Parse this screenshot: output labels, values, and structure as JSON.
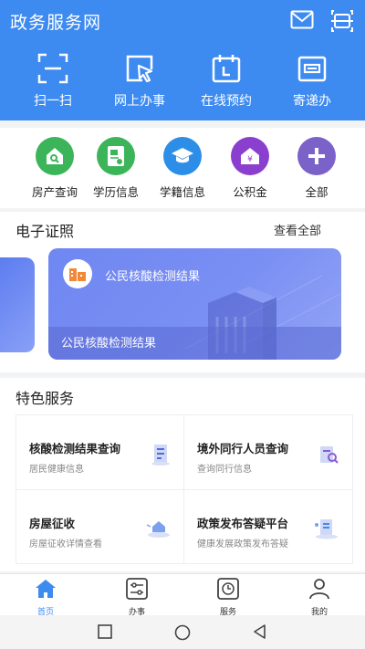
{
  "header": {
    "title": "政务服务网",
    "mail_icon": "mail-icon",
    "scan_icon": "scan-frame-icon"
  },
  "quick_actions": [
    {
      "label": "扫一扫",
      "icon": "scan-icon"
    },
    {
      "label": "网上办事",
      "icon": "cursor-window-icon"
    },
    {
      "label": "在线预约",
      "icon": "calendar-icon"
    },
    {
      "label": "寄递办",
      "icon": "mailbox-icon"
    }
  ],
  "categories": [
    {
      "label": "房产查询",
      "icon": "house-icon",
      "color": "#3cb55a"
    },
    {
      "label": "学历信息",
      "icon": "certificate-icon",
      "color": "#3cb55a"
    },
    {
      "label": "学籍信息",
      "icon": "graduation-cap-icon",
      "color": "#2d8ee8"
    },
    {
      "label": "公积金",
      "icon": "yuan-house-icon",
      "color": "#8b3fcf"
    },
    {
      "label": "全部",
      "icon": "plus-icon",
      "color": "#7b62c9"
    }
  ],
  "e_certificate": {
    "title": "电子证照",
    "see_all": "查看全部",
    "card_title": "公民核酸检测结果",
    "card_footer": "公民核酸检测结果"
  },
  "special_services": {
    "title": "特色服务",
    "items": [
      {
        "title": "核酸检测结果查询",
        "subtitle": "居民健康信息"
      },
      {
        "title": "境外同行人员查询",
        "subtitle": "查询同行信息"
      },
      {
        "title": "房屋征收",
        "subtitle": "房屋征收详情查看"
      },
      {
        "title": "政策发布答疑平台",
        "subtitle": "健康发展政策发布答疑"
      }
    ]
  },
  "tabbar": [
    {
      "label": "首页",
      "active": true
    },
    {
      "label": "办事",
      "active": false
    },
    {
      "label": "服务",
      "active": false
    },
    {
      "label": "我的",
      "active": false
    }
  ],
  "colors": {
    "primary": "#3d8bf0",
    "card_gradient": "#7a8ff3"
  }
}
